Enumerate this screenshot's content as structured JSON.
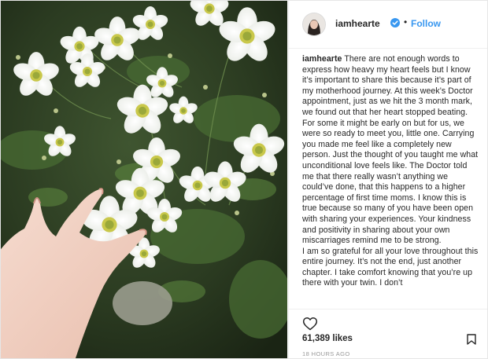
{
  "header": {
    "username": "iamhearte",
    "separator": "•",
    "follow_label": "Follow"
  },
  "caption": {
    "username": "iamhearte",
    "paragraphs": [
      "There are not enough words to express how heavy my heart feels but I know it’s important to share this because it’s part of my motherhood journey. At this week’s Doctor appointment, just as we hit the 3 month mark, we found out that her heart stopped beating.",
      "For some it might be early on but for us, we were so ready to meet you, little one. Carrying you made me feel like a completely new person. Just the thought of you taught me what unconditional love feels like. The Doctor told me that there really wasn’t anything we could’ve done, that this happens to a higher percentage of first time moms. I know this is true because so many of you have been open with sharing your experiences. Your kindness and positivity in sharing about your own miscarriages remind me to be strong.",
      "I am so grateful for all your love throughout this entire journey. It’s not the end, just another chapter. I take comfort knowing that you’re up there with your twin. I don’t"
    ]
  },
  "actions": {
    "likes": "61,389 likes",
    "timestamp": "18 HOURS AGO"
  },
  "icons": {
    "verified": "verified-badge-icon",
    "heart": "heart-outline-icon",
    "bookmark": "bookmark-outline-icon"
  },
  "colors": {
    "link_blue": "#3897f0",
    "verified_blue": "#3897f0",
    "text": "#262626",
    "muted": "#999999"
  }
}
